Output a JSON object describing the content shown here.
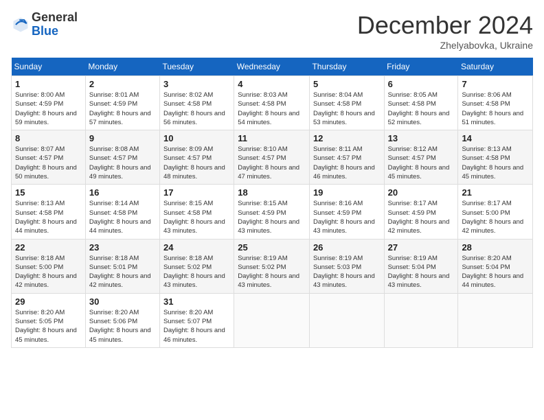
{
  "header": {
    "logo_general": "General",
    "logo_blue": "Blue",
    "month_title": "December 2024",
    "location": "Zhelyabovka, Ukraine"
  },
  "days_of_week": [
    "Sunday",
    "Monday",
    "Tuesday",
    "Wednesday",
    "Thursday",
    "Friday",
    "Saturday"
  ],
  "weeks": [
    [
      {
        "day": 1,
        "sunrise": "8:00 AM",
        "sunset": "4:59 PM",
        "daylight": "8 hours and 59 minutes."
      },
      {
        "day": 2,
        "sunrise": "8:01 AM",
        "sunset": "4:59 PM",
        "daylight": "8 hours and 57 minutes."
      },
      {
        "day": 3,
        "sunrise": "8:02 AM",
        "sunset": "4:58 PM",
        "daylight": "8 hours and 56 minutes."
      },
      {
        "day": 4,
        "sunrise": "8:03 AM",
        "sunset": "4:58 PM",
        "daylight": "8 hours and 54 minutes."
      },
      {
        "day": 5,
        "sunrise": "8:04 AM",
        "sunset": "4:58 PM",
        "daylight": "8 hours and 53 minutes."
      },
      {
        "day": 6,
        "sunrise": "8:05 AM",
        "sunset": "4:58 PM",
        "daylight": "8 hours and 52 minutes."
      },
      {
        "day": 7,
        "sunrise": "8:06 AM",
        "sunset": "4:58 PM",
        "daylight": "8 hours and 51 minutes."
      }
    ],
    [
      {
        "day": 8,
        "sunrise": "8:07 AM",
        "sunset": "4:57 PM",
        "daylight": "8 hours and 50 minutes."
      },
      {
        "day": 9,
        "sunrise": "8:08 AM",
        "sunset": "4:57 PM",
        "daylight": "8 hours and 49 minutes."
      },
      {
        "day": 10,
        "sunrise": "8:09 AM",
        "sunset": "4:57 PM",
        "daylight": "8 hours and 48 minutes."
      },
      {
        "day": 11,
        "sunrise": "8:10 AM",
        "sunset": "4:57 PM",
        "daylight": "8 hours and 47 minutes."
      },
      {
        "day": 12,
        "sunrise": "8:11 AM",
        "sunset": "4:57 PM",
        "daylight": "8 hours and 46 minutes."
      },
      {
        "day": 13,
        "sunrise": "8:12 AM",
        "sunset": "4:57 PM",
        "daylight": "8 hours and 45 minutes."
      },
      {
        "day": 14,
        "sunrise": "8:13 AM",
        "sunset": "4:58 PM",
        "daylight": "8 hours and 45 minutes."
      }
    ],
    [
      {
        "day": 15,
        "sunrise": "8:13 AM",
        "sunset": "4:58 PM",
        "daylight": "8 hours and 44 minutes."
      },
      {
        "day": 16,
        "sunrise": "8:14 AM",
        "sunset": "4:58 PM",
        "daylight": "8 hours and 44 minutes."
      },
      {
        "day": 17,
        "sunrise": "8:15 AM",
        "sunset": "4:58 PM",
        "daylight": "8 hours and 43 minutes."
      },
      {
        "day": 18,
        "sunrise": "8:15 AM",
        "sunset": "4:59 PM",
        "daylight": "8 hours and 43 minutes."
      },
      {
        "day": 19,
        "sunrise": "8:16 AM",
        "sunset": "4:59 PM",
        "daylight": "8 hours and 43 minutes."
      },
      {
        "day": 20,
        "sunrise": "8:17 AM",
        "sunset": "4:59 PM",
        "daylight": "8 hours and 42 minutes."
      },
      {
        "day": 21,
        "sunrise": "8:17 AM",
        "sunset": "5:00 PM",
        "daylight": "8 hours and 42 minutes."
      }
    ],
    [
      {
        "day": 22,
        "sunrise": "8:18 AM",
        "sunset": "5:00 PM",
        "daylight": "8 hours and 42 minutes."
      },
      {
        "day": 23,
        "sunrise": "8:18 AM",
        "sunset": "5:01 PM",
        "daylight": "8 hours and 42 minutes."
      },
      {
        "day": 24,
        "sunrise": "8:18 AM",
        "sunset": "5:02 PM",
        "daylight": "8 hours and 43 minutes."
      },
      {
        "day": 25,
        "sunrise": "8:19 AM",
        "sunset": "5:02 PM",
        "daylight": "8 hours and 43 minutes."
      },
      {
        "day": 26,
        "sunrise": "8:19 AM",
        "sunset": "5:03 PM",
        "daylight": "8 hours and 43 minutes."
      },
      {
        "day": 27,
        "sunrise": "8:19 AM",
        "sunset": "5:04 PM",
        "daylight": "8 hours and 43 minutes."
      },
      {
        "day": 28,
        "sunrise": "8:20 AM",
        "sunset": "5:04 PM",
        "daylight": "8 hours and 44 minutes."
      }
    ],
    [
      {
        "day": 29,
        "sunrise": "8:20 AM",
        "sunset": "5:05 PM",
        "daylight": "8 hours and 45 minutes."
      },
      {
        "day": 30,
        "sunrise": "8:20 AM",
        "sunset": "5:06 PM",
        "daylight": "8 hours and 45 minutes."
      },
      {
        "day": 31,
        "sunrise": "8:20 AM",
        "sunset": "5:07 PM",
        "daylight": "8 hours and 46 minutes."
      },
      null,
      null,
      null,
      null
    ]
  ],
  "labels": {
    "sunrise": "Sunrise:",
    "sunset": "Sunset:",
    "daylight": "Daylight:"
  }
}
